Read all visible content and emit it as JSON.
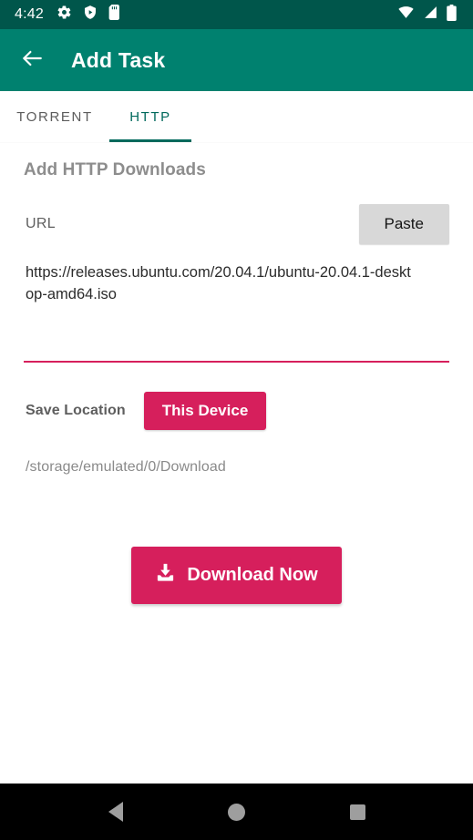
{
  "status_bar": {
    "time": "4:42",
    "left_icons": [
      "gear-icon",
      "shield-play-icon",
      "sd-card-icon"
    ],
    "right_icons": [
      "wifi-icon",
      "cell-signal-icon",
      "battery-icon"
    ],
    "background_color": "#00564B"
  },
  "app_bar": {
    "title": "Add Task",
    "back_icon": "arrow-left-icon",
    "background_color": "#00816F"
  },
  "tabs": [
    {
      "label": "TORRENT",
      "active": false
    },
    {
      "label": "HTTP",
      "active": true
    }
  ],
  "main": {
    "heading": "Add HTTP Downloads",
    "url_label": "URL",
    "paste_label": "Paste",
    "url_value": "https://releases.ubuntu.com/20.04.1/ubuntu-20.04.1-desktop-amd64.iso",
    "url_placeholder": "URL",
    "save_location_label": "Save Location",
    "save_location_value": "This Device",
    "path": "/storage/emulated/0/Download",
    "download_label": "Download Now",
    "download_icon": "download-icon",
    "accent_color": "#D61F5C"
  },
  "nav_bar": {
    "back": "triangle-back-icon",
    "home": "circle-home-icon",
    "recents": "square-recents-icon"
  }
}
